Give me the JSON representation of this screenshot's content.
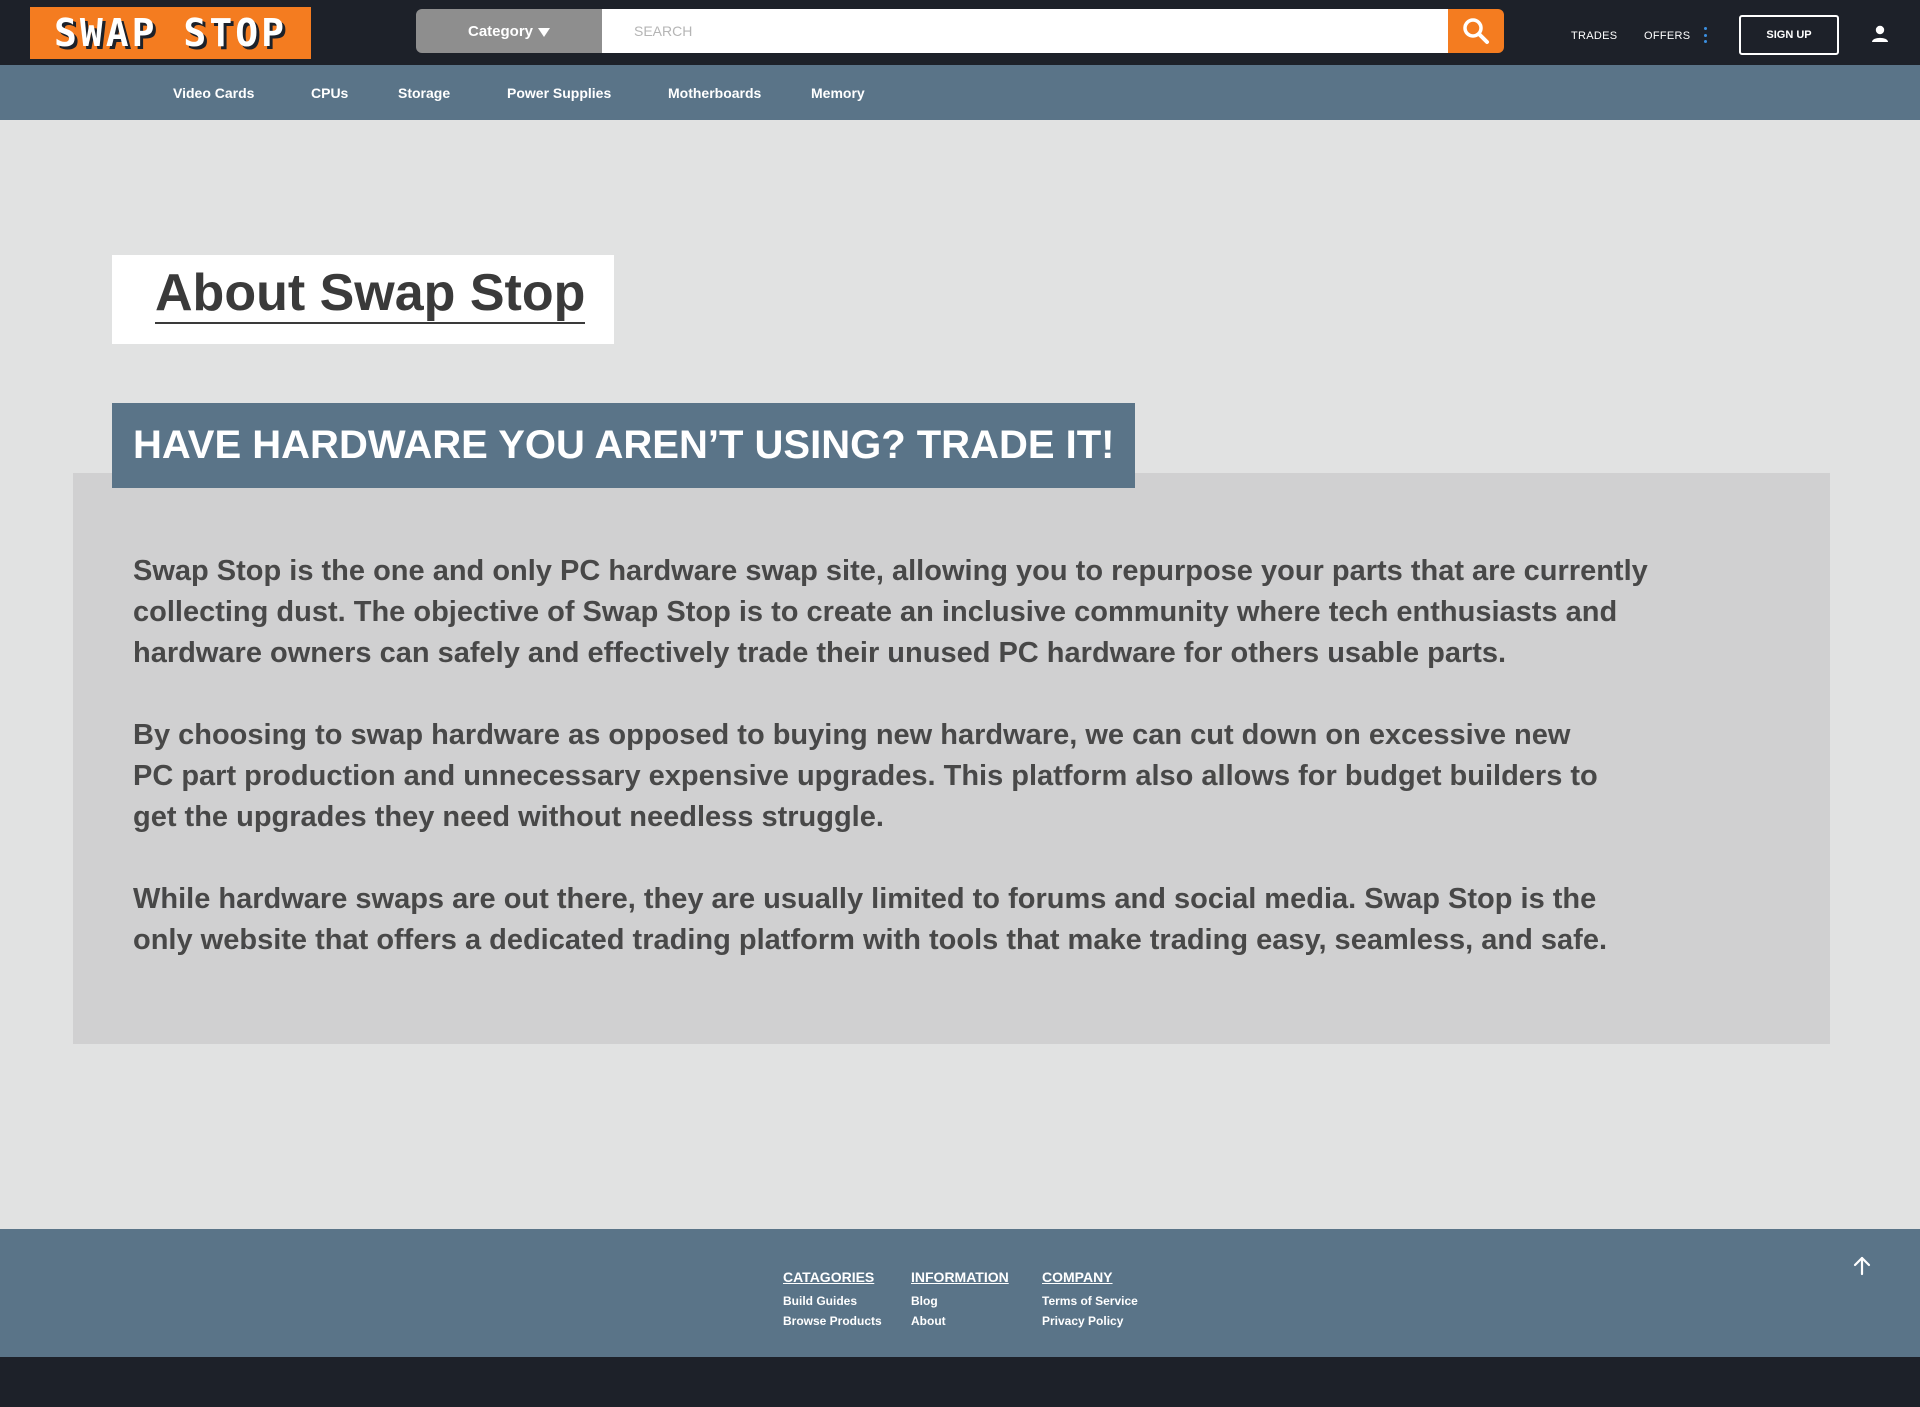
{
  "header": {
    "logo_text": "SWAP STOP",
    "category_label": "Category",
    "search_placeholder": "SEARCH",
    "nav_trades": "TRADES",
    "nav_offers": "OFFERS",
    "signup_label": "SIGN UP"
  },
  "catnav": {
    "items": [
      "Video Cards",
      "CPUs",
      "Storage",
      "Power Supplies",
      "Motherboards",
      "Memory"
    ]
  },
  "main": {
    "page_title": "About Swap Stop",
    "banner_heading": "HAVE HARDWARE YOU AREN’T USING? TRADE IT!",
    "paragraphs": [
      [
        "Swap Stop is the one and only PC hardware swap site, allowing you to repurpose your parts that are currently",
        "collecting dust. The objective of Swap Stop is to create an inclusive community where tech enthusiasts and",
        "hardware owners can safely and effectively trade their unused PC hardware for others usable parts."
      ],
      [
        "By choosing to swap hardware as opposed to buying new hardware, we can cut down on excessive new",
        "PC part production and unnecessary expensive upgrades. This platform also allows for budget builders to",
        "get the upgrades they need without needless struggle."
      ],
      [
        "While hardware swaps are out there, they are usually limited to forums and social media. Swap Stop is the",
        "only website that offers a dedicated trading platform with tools that make trading easy, seamless, and safe."
      ]
    ]
  },
  "footer": {
    "columns": [
      {
        "heading": "CATAGORIES",
        "links": [
          "Build Guides",
          "Browse Products"
        ]
      },
      {
        "heading": "INFORMATION",
        "links": [
          "Blog",
          "About"
        ]
      },
      {
        "heading": "COMPANY",
        "links": [
          "Terms of Service",
          "Privacy Policy"
        ]
      }
    ]
  },
  "icons": {
    "search": "search-icon",
    "user": "user-icon",
    "more": "kebab-menu-icon",
    "dropdown": "caret-down-icon",
    "back_to_top": "arrow-up-icon"
  },
  "colors": {
    "accent_orange": "#f47c20",
    "nav_slate": "#5a7488",
    "dark": "#1d2129",
    "page_bg": "#e1e2e2",
    "panel_bg": "#d0d0d1"
  }
}
